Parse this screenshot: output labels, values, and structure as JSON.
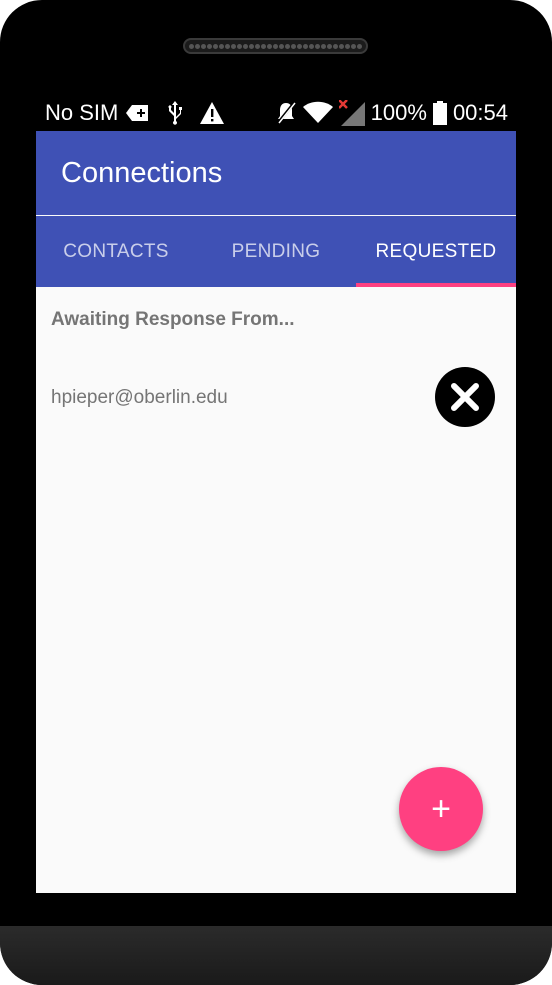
{
  "status_bar": {
    "carrier": "No SIM",
    "battery": "100%",
    "time": "00:54",
    "icons": [
      "sim-plus-icon",
      "usb-icon",
      "warning-icon",
      "mute-icon",
      "wifi-icon",
      "signal-icon",
      "battery-icon"
    ]
  },
  "app_bar": {
    "title": "Connections",
    "color": "#3f51b5"
  },
  "tabs": [
    {
      "label": "CONTACTS",
      "active": false
    },
    {
      "label": "PENDING",
      "active": false
    },
    {
      "label": "REQUESTED",
      "active": true
    }
  ],
  "indicator_color": "#ff4081",
  "section_header": "Awaiting Response From...",
  "requests": [
    {
      "email": "hpieper@oberlin.edu",
      "action_icon": "close-icon"
    }
  ],
  "fab": {
    "label": "+",
    "icon": "plus-icon",
    "color": "#ff4081"
  }
}
